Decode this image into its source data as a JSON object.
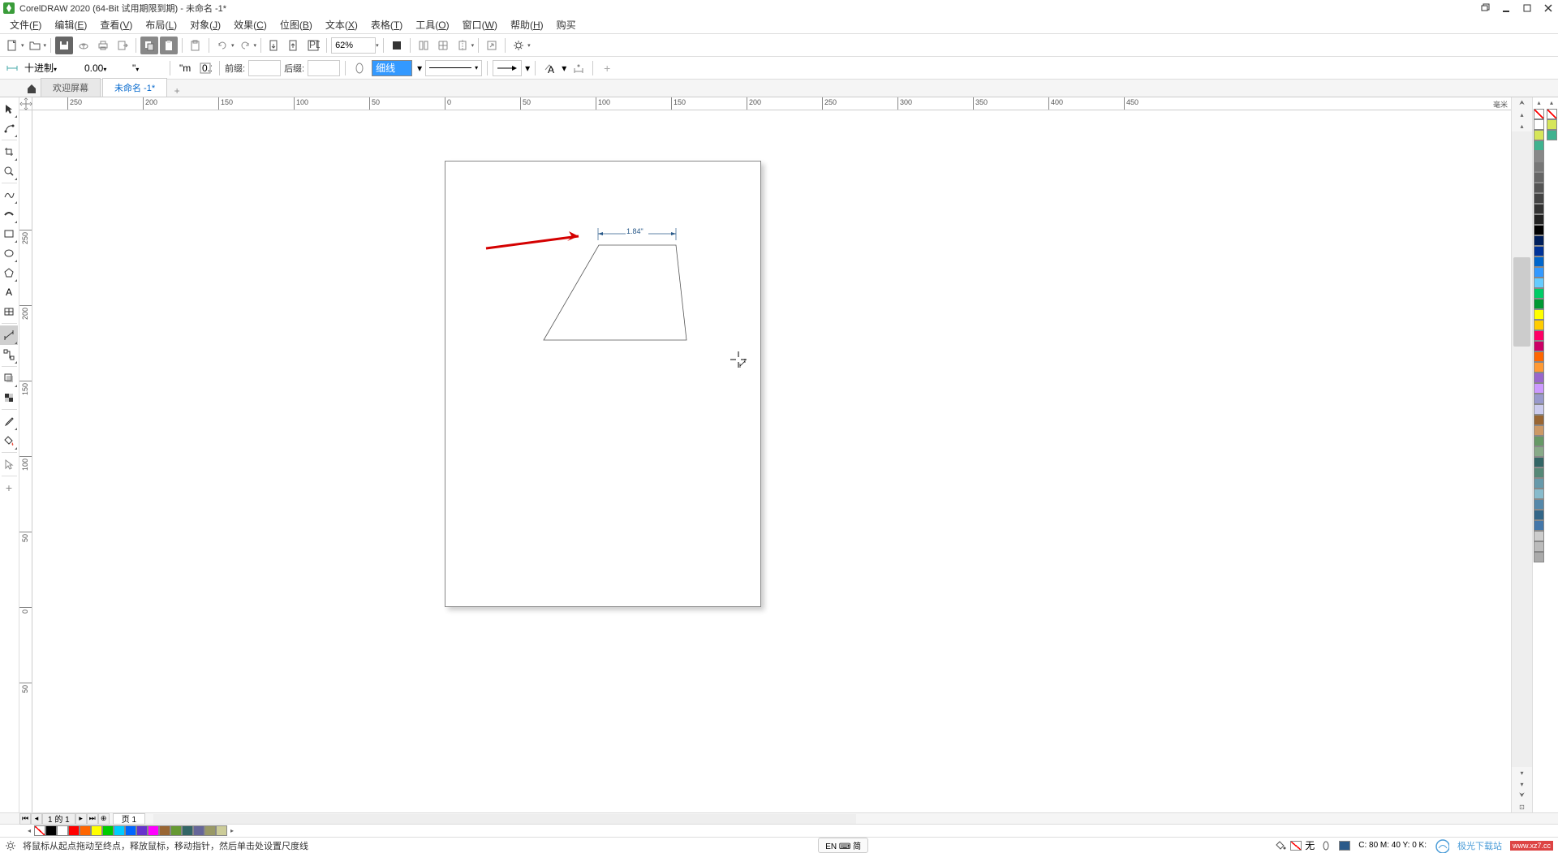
{
  "titlebar": {
    "title": "CorelDRAW 2020 (64-Bit 试用期限到期) - 未命名 -1*"
  },
  "menubar": {
    "items": [
      {
        "label": "文件",
        "key": "F"
      },
      {
        "label": "编辑",
        "key": "E"
      },
      {
        "label": "查看",
        "key": "V"
      },
      {
        "label": "布局",
        "key": "L"
      },
      {
        "label": "对象",
        "key": "J"
      },
      {
        "label": "效果",
        "key": "C"
      },
      {
        "label": "位图",
        "key": "B"
      },
      {
        "label": "文本",
        "key": "X"
      },
      {
        "label": "表格",
        "key": "T"
      },
      {
        "label": "工具",
        "key": "O"
      },
      {
        "label": "窗口",
        "key": "W"
      },
      {
        "label": "帮助",
        "key": "H"
      },
      {
        "label": "购买",
        "key": ""
      }
    ]
  },
  "toolbar1": {
    "zoom": "62%"
  },
  "propbar": {
    "dim_style": "十进制",
    "precision": "0.00",
    "units": "\"",
    "prefix_label": "前缀:",
    "prefix_value": "",
    "suffix_label": "后缀:",
    "suffix_value": "",
    "outline_width": "细线"
  },
  "tabs": {
    "welcome": "欢迎屏幕",
    "doc": "未命名 -1*"
  },
  "ruler": {
    "unit_label": "毫米",
    "h_ticks": [
      -250,
      -200,
      -150,
      -100,
      -50,
      0,
      50,
      100,
      150,
      200,
      250,
      300,
      350,
      400,
      450
    ],
    "v_ticks": [
      250,
      200,
      150,
      100,
      50,
      0,
      -50
    ]
  },
  "drawing": {
    "dimension_value": "1.84\""
  },
  "pagenav": {
    "info": "1 的 1",
    "pagetab": "页 1"
  },
  "statusbar": {
    "hint": "将鼠标从起点拖动至终点，释放鼠标，移动指针，然后单击处设置尺度线",
    "ime": "EN ⌨ 简",
    "fill_label": "无",
    "coords": "C:  80 M:  40 Y:   0 K:",
    "watermark": "极光下载站",
    "watermark_url": "www.xz7.cc"
  },
  "palette": {
    "right_colors": [
      "#ffffff",
      "#d6e65a",
      "#3fb28f",
      "#888888",
      "#777777",
      "#666666",
      "#555555",
      "#444444",
      "#333333",
      "#222222",
      "#000000",
      "#001f5b",
      "#003399",
      "#0066cc",
      "#3399ff",
      "#66ccff",
      "#00cc66",
      "#009933",
      "#ffff00",
      "#ffcc00",
      "#ff0066",
      "#cc0066",
      "#ff6600",
      "#ff9933",
      "#9966cc",
      "#cc99ff",
      "#9999cc",
      "#ccccee",
      "#996633",
      "#cc9966",
      "#669966",
      "#88aa88",
      "#336666",
      "#558877",
      "#6699aa",
      "#88bbcc",
      "#5588aa",
      "#336688",
      "#4477aa",
      "#cccccc",
      "#bbbbbb",
      "#aaaaaa"
    ],
    "bottom_colors": [
      "#000000",
      "#ffffff",
      "#ff0000",
      "#ff6600",
      "#ffff00",
      "#00cc00",
      "#00ccff",
      "#0066ff",
      "#6633cc",
      "#ff00ff",
      "#996633",
      "#669933",
      "#336666",
      "#666699",
      "#999966",
      "#cccc99"
    ]
  }
}
